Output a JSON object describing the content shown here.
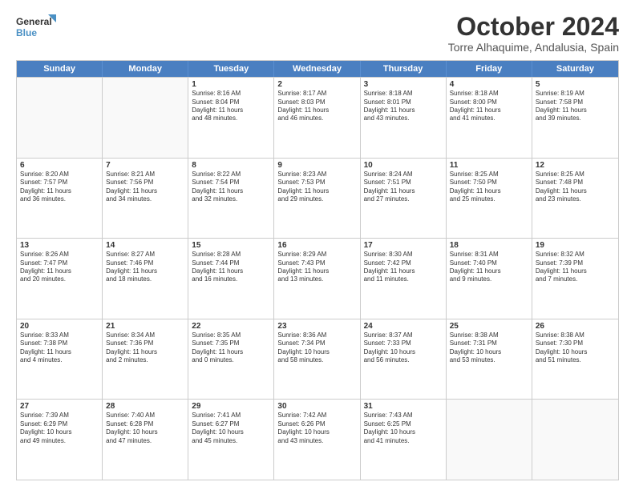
{
  "logo": {
    "line1": "General",
    "line2": "Blue"
  },
  "title": "October 2024",
  "subtitle": "Torre Alhaquime, Andalusia, Spain",
  "header_days": [
    "Sunday",
    "Monday",
    "Tuesday",
    "Wednesday",
    "Thursday",
    "Friday",
    "Saturday"
  ],
  "weeks": [
    [
      {
        "day": "",
        "lines": []
      },
      {
        "day": "",
        "lines": []
      },
      {
        "day": "1",
        "lines": [
          "Sunrise: 8:16 AM",
          "Sunset: 8:04 PM",
          "Daylight: 11 hours",
          "and 48 minutes."
        ]
      },
      {
        "day": "2",
        "lines": [
          "Sunrise: 8:17 AM",
          "Sunset: 8:03 PM",
          "Daylight: 11 hours",
          "and 46 minutes."
        ]
      },
      {
        "day": "3",
        "lines": [
          "Sunrise: 8:18 AM",
          "Sunset: 8:01 PM",
          "Daylight: 11 hours",
          "and 43 minutes."
        ]
      },
      {
        "day": "4",
        "lines": [
          "Sunrise: 8:18 AM",
          "Sunset: 8:00 PM",
          "Daylight: 11 hours",
          "and 41 minutes."
        ]
      },
      {
        "day": "5",
        "lines": [
          "Sunrise: 8:19 AM",
          "Sunset: 7:58 PM",
          "Daylight: 11 hours",
          "and 39 minutes."
        ]
      }
    ],
    [
      {
        "day": "6",
        "lines": [
          "Sunrise: 8:20 AM",
          "Sunset: 7:57 PM",
          "Daylight: 11 hours",
          "and 36 minutes."
        ]
      },
      {
        "day": "7",
        "lines": [
          "Sunrise: 8:21 AM",
          "Sunset: 7:56 PM",
          "Daylight: 11 hours",
          "and 34 minutes."
        ]
      },
      {
        "day": "8",
        "lines": [
          "Sunrise: 8:22 AM",
          "Sunset: 7:54 PM",
          "Daylight: 11 hours",
          "and 32 minutes."
        ]
      },
      {
        "day": "9",
        "lines": [
          "Sunrise: 8:23 AM",
          "Sunset: 7:53 PM",
          "Daylight: 11 hours",
          "and 29 minutes."
        ]
      },
      {
        "day": "10",
        "lines": [
          "Sunrise: 8:24 AM",
          "Sunset: 7:51 PM",
          "Daylight: 11 hours",
          "and 27 minutes."
        ]
      },
      {
        "day": "11",
        "lines": [
          "Sunrise: 8:25 AM",
          "Sunset: 7:50 PM",
          "Daylight: 11 hours",
          "and 25 minutes."
        ]
      },
      {
        "day": "12",
        "lines": [
          "Sunrise: 8:25 AM",
          "Sunset: 7:48 PM",
          "Daylight: 11 hours",
          "and 23 minutes."
        ]
      }
    ],
    [
      {
        "day": "13",
        "lines": [
          "Sunrise: 8:26 AM",
          "Sunset: 7:47 PM",
          "Daylight: 11 hours",
          "and 20 minutes."
        ]
      },
      {
        "day": "14",
        "lines": [
          "Sunrise: 8:27 AM",
          "Sunset: 7:46 PM",
          "Daylight: 11 hours",
          "and 18 minutes."
        ]
      },
      {
        "day": "15",
        "lines": [
          "Sunrise: 8:28 AM",
          "Sunset: 7:44 PM",
          "Daylight: 11 hours",
          "and 16 minutes."
        ]
      },
      {
        "day": "16",
        "lines": [
          "Sunrise: 8:29 AM",
          "Sunset: 7:43 PM",
          "Daylight: 11 hours",
          "and 13 minutes."
        ]
      },
      {
        "day": "17",
        "lines": [
          "Sunrise: 8:30 AM",
          "Sunset: 7:42 PM",
          "Daylight: 11 hours",
          "and 11 minutes."
        ]
      },
      {
        "day": "18",
        "lines": [
          "Sunrise: 8:31 AM",
          "Sunset: 7:40 PM",
          "Daylight: 11 hours",
          "and 9 minutes."
        ]
      },
      {
        "day": "19",
        "lines": [
          "Sunrise: 8:32 AM",
          "Sunset: 7:39 PM",
          "Daylight: 11 hours",
          "and 7 minutes."
        ]
      }
    ],
    [
      {
        "day": "20",
        "lines": [
          "Sunrise: 8:33 AM",
          "Sunset: 7:38 PM",
          "Daylight: 11 hours",
          "and 4 minutes."
        ]
      },
      {
        "day": "21",
        "lines": [
          "Sunrise: 8:34 AM",
          "Sunset: 7:36 PM",
          "Daylight: 11 hours",
          "and 2 minutes."
        ]
      },
      {
        "day": "22",
        "lines": [
          "Sunrise: 8:35 AM",
          "Sunset: 7:35 PM",
          "Daylight: 11 hours",
          "and 0 minutes."
        ]
      },
      {
        "day": "23",
        "lines": [
          "Sunrise: 8:36 AM",
          "Sunset: 7:34 PM",
          "Daylight: 10 hours",
          "and 58 minutes."
        ]
      },
      {
        "day": "24",
        "lines": [
          "Sunrise: 8:37 AM",
          "Sunset: 7:33 PM",
          "Daylight: 10 hours",
          "and 56 minutes."
        ]
      },
      {
        "day": "25",
        "lines": [
          "Sunrise: 8:38 AM",
          "Sunset: 7:31 PM",
          "Daylight: 10 hours",
          "and 53 minutes."
        ]
      },
      {
        "day": "26",
        "lines": [
          "Sunrise: 8:38 AM",
          "Sunset: 7:30 PM",
          "Daylight: 10 hours",
          "and 51 minutes."
        ]
      }
    ],
    [
      {
        "day": "27",
        "lines": [
          "Sunrise: 7:39 AM",
          "Sunset: 6:29 PM",
          "Daylight: 10 hours",
          "and 49 minutes."
        ]
      },
      {
        "day": "28",
        "lines": [
          "Sunrise: 7:40 AM",
          "Sunset: 6:28 PM",
          "Daylight: 10 hours",
          "and 47 minutes."
        ]
      },
      {
        "day": "29",
        "lines": [
          "Sunrise: 7:41 AM",
          "Sunset: 6:27 PM",
          "Daylight: 10 hours",
          "and 45 minutes."
        ]
      },
      {
        "day": "30",
        "lines": [
          "Sunrise: 7:42 AM",
          "Sunset: 6:26 PM",
          "Daylight: 10 hours",
          "and 43 minutes."
        ]
      },
      {
        "day": "31",
        "lines": [
          "Sunrise: 7:43 AM",
          "Sunset: 6:25 PM",
          "Daylight: 10 hours",
          "and 41 minutes."
        ]
      },
      {
        "day": "",
        "lines": []
      },
      {
        "day": "",
        "lines": []
      }
    ]
  ]
}
